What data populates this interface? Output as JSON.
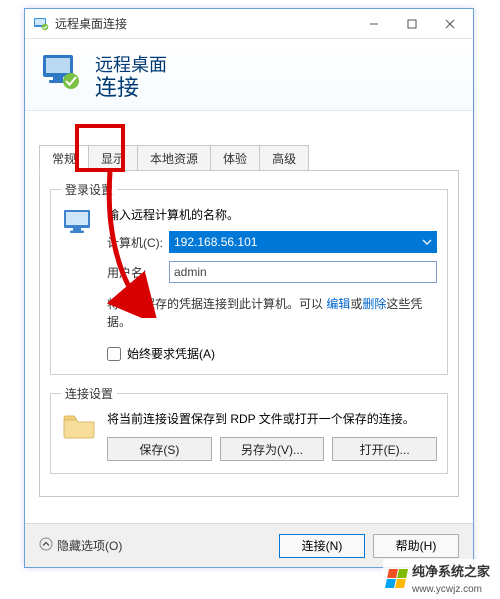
{
  "window": {
    "title": "远程桌面连接"
  },
  "banner": {
    "line1": "远程桌面",
    "line2": "连接"
  },
  "tabs": [
    {
      "id": "general",
      "label": "常规",
      "active": true
    },
    {
      "id": "display",
      "label": "显示",
      "active": false
    },
    {
      "id": "localres",
      "label": "本地资源",
      "active": false
    },
    {
      "id": "exp",
      "label": "体验",
      "active": false
    },
    {
      "id": "adv",
      "label": "高级",
      "active": false
    }
  ],
  "login": {
    "legend": "登录设置",
    "intro": "输入远程计算机的名称。",
    "computer_label": "计算机(C):",
    "computer_value": "192.168.56.101",
    "user_label": "用户名:",
    "user_value": "admin",
    "hint_prefix": "将使用保存的凭据连接到此计算机。可以",
    "hint_edit": "编辑",
    "hint_or": "或",
    "hint_delete": "删除",
    "hint_suffix": "这些凭据。",
    "always_cred": "始终要求凭据(A)"
  },
  "conn": {
    "legend": "连接设置",
    "desc": "将当前连接设置保存到 RDP 文件或打开一个保存的连接。",
    "save": "保存(S)",
    "saveas": "另存为(V)...",
    "open": "打开(E)..."
  },
  "footer": {
    "hide_options": "隐藏选项(O)",
    "connect": "连接(N)",
    "help": "帮助(H)"
  },
  "watermark": {
    "name": "纯净系统之家",
    "url": "www.ycwjz.com"
  },
  "colors": {
    "logo": [
      "#f25022",
      "#7fba00",
      "#00a4ef",
      "#ffb900"
    ]
  }
}
